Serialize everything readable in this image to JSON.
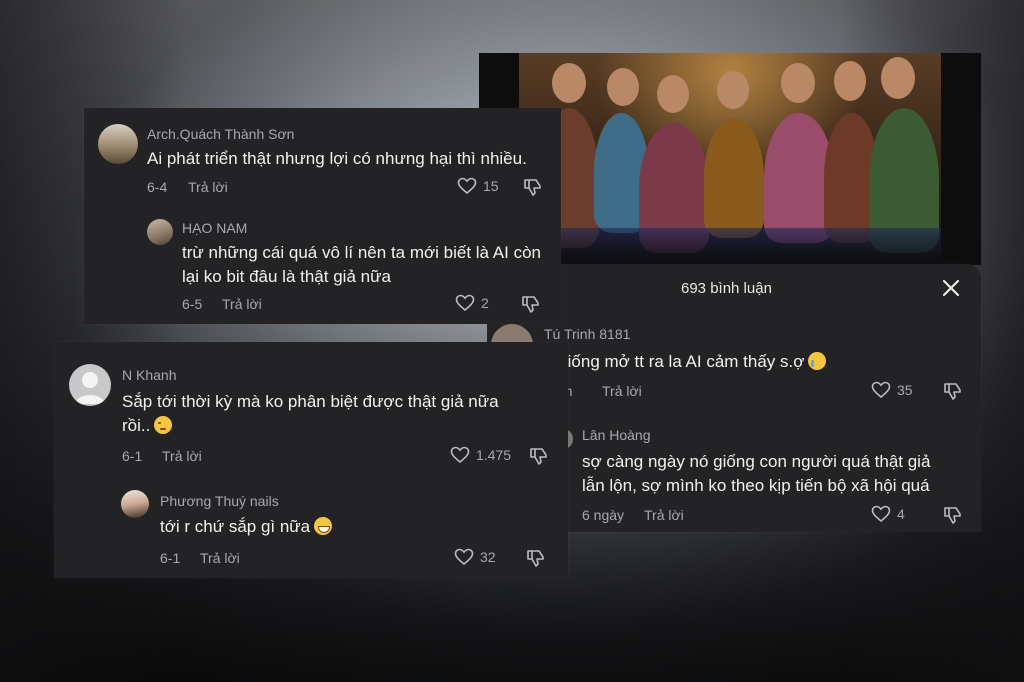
{
  "right_panel": {
    "comment_count": "693 bình luận",
    "comments": [
      {
        "name": "Tú Trinh 8181",
        "text": "o giống mở tt ra la AI cảm thấy s.ợ",
        "emoji": "crying-face",
        "date": "ần",
        "reply": "Trả lời",
        "likes": "35"
      },
      {
        "name": "Lân Hoàng",
        "text_line1": "sợ càng ngày nó giống con người quá thật giả",
        "text_line2": "lẫn lộn, sợ mình ko theo kịp tiến bộ xã hội quá",
        "date": "6 ngày",
        "reply": "Trả lời",
        "likes": "4"
      }
    ]
  },
  "top_panel": {
    "comments": [
      {
        "name": "Arch.Quách Thành Sơn",
        "text": "Ai phát triển thật nhưng lợi có nhưng hại thì nhiều.",
        "date": "6-4",
        "reply": "Trả lời",
        "likes": "15"
      },
      {
        "name": "HẠO NAM",
        "text_line1": "trừ những cái quá vô lí nên ta mới biết là AI còn",
        "text_line2": "lại ko bit đâu là thật giả nữa",
        "date": "6-5",
        "reply": "Trả lời",
        "likes": "2"
      }
    ]
  },
  "bottom_panel": {
    "comments": [
      {
        "name": "N Khanh",
        "text_line1": "Sắp tới thời kỳ mà ko phân biệt được thật giả nữa",
        "text_line2": "rồi..",
        "emoji": "pensive-face",
        "date": "6-1",
        "reply": "Trả lời",
        "likes": "1.475"
      },
      {
        "name": "Phương Thuý nails",
        "text": "tới r chứ sắp gì nữa",
        "emoji": "grinning-face",
        "date": "6-1",
        "reply": "Trả lời",
        "likes": "32"
      }
    ]
  },
  "colors": {
    "panel_bg": "#232325",
    "text": "#f1f1f1",
    "muted": "#a9a9ad"
  }
}
